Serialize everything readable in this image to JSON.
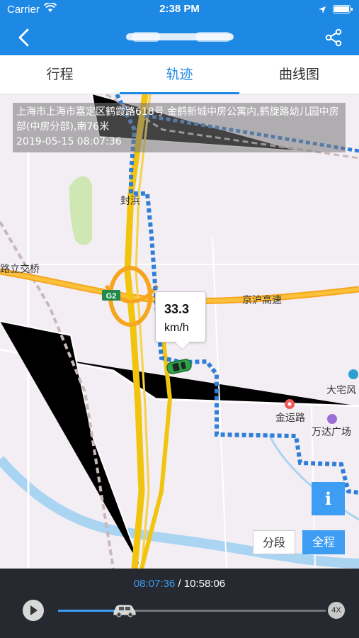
{
  "status_bar": {
    "carrier": "Carrier",
    "time": "2:38 PM",
    "icons": [
      "wifi-icon",
      "location-arrow-icon",
      "battery-icon"
    ]
  },
  "nav": {
    "back_icon": "chevron-left-icon",
    "title": "",
    "share_icon": "share-icon"
  },
  "tabs": [
    {
      "label": "行程",
      "active": false
    },
    {
      "label": "轨迹",
      "active": true
    },
    {
      "label": "曲线图",
      "active": false
    }
  ],
  "map": {
    "address": "上海市上海市嘉定区鹤霞路618号 金鹤新城中房公寓内,鹤旋路幼儿园中房部(中房分部),南76米",
    "timestamp": "2019-05-15 08:07:36",
    "labels": {
      "fenghuang": "封浜",
      "lijiaoqiao": "路立交桥",
      "jinghu": "京沪高速",
      "g2": "G2",
      "jinyunlu": "金运路",
      "wanda": "万达广场",
      "dazhai": "大宅风"
    },
    "speed": {
      "value": "33.3",
      "unit": "km/h"
    },
    "info_label": "i",
    "segment_label": "分段",
    "full_label": "全程"
  },
  "player": {
    "current_time": "08:07:36",
    "separator": " / ",
    "total_time": "10:58:06",
    "progress": 0.23,
    "speed_multiplier": "4X"
  },
  "colors": {
    "primary": "#1e88e5",
    "route": "#2f7fd9",
    "highway": "#f5a623",
    "player_bg": "#26292f"
  }
}
